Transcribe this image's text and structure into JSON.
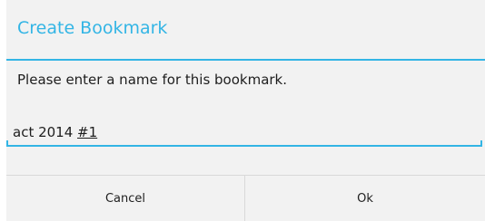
{
  "dialog": {
    "title": "Create Bookmark",
    "message": "Please enter a name for this bookmark.",
    "name_field": {
      "value_prefix": "act 2014 ",
      "value_composing": "#1"
    },
    "buttons": {
      "cancel_label": "Cancel",
      "ok_label": "Ok"
    }
  },
  "colors": {
    "accent": "#33b5e5",
    "dialog_background": "#f2f2f2"
  }
}
